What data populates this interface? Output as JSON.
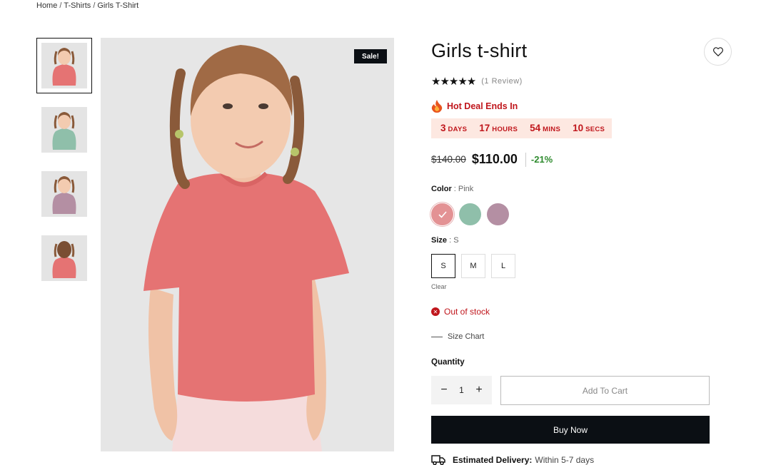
{
  "breadcrumb": [
    "Home",
    "T-Shirts",
    "Girls T-Shirt"
  ],
  "breadcrumb_sep": "/",
  "thumbnails": [
    {
      "name": "pink",
      "shirt_color": "#e57373",
      "view": "front"
    },
    {
      "name": "green",
      "shirt_color": "#8fbfaa",
      "view": "front"
    },
    {
      "name": "mauve",
      "shirt_color": "#b48fa3",
      "view": "front"
    },
    {
      "name": "pink-back",
      "shirt_color": "#e57373",
      "view": "back"
    }
  ],
  "badge": {
    "sale": "Sale!"
  },
  "product": {
    "title": "Girls t-shirt",
    "stars": "★★★★★",
    "review_count": "(1 Review)"
  },
  "deal": {
    "label": "Hot Deal Ends In",
    "days_num": "3",
    "days_lbl": "DAYS",
    "hours_num": "17",
    "hours_lbl": "HOURS",
    "mins_num": "54",
    "mins_lbl": "MINS",
    "secs_num": "10",
    "secs_lbl": "SECS"
  },
  "price": {
    "old": "$140.00",
    "new": "$110.00",
    "discount": "-21%"
  },
  "color": {
    "label": "Color",
    "selected": "Pink",
    "swatches": [
      {
        "name": "Pink",
        "hex": "#e39294"
      },
      {
        "name": "Green",
        "hex": "#8fbfaa"
      },
      {
        "name": "Mauve",
        "hex": "#b48fa3"
      }
    ]
  },
  "size": {
    "label": "Size",
    "selected": "S",
    "options": [
      "S",
      "M",
      "L"
    ],
    "clear": "Clear"
  },
  "stock": {
    "text": "Out of stock",
    "color": "#c0161c"
  },
  "size_chart": "Size Chart",
  "quantity": {
    "label": "Quantity",
    "value": "1",
    "minus": "−",
    "plus": "+"
  },
  "actions": {
    "add_to_cart": "Add To Cart",
    "buy_now": "Buy Now"
  },
  "delivery": {
    "label": "Estimated Delivery:",
    "value": "Within 5-7 days"
  },
  "colors": {
    "accent": "#c0161c",
    "dark": "#0b0f14",
    "discount": "#2e8b2e",
    "countdown_bg": "#fde8e1"
  }
}
